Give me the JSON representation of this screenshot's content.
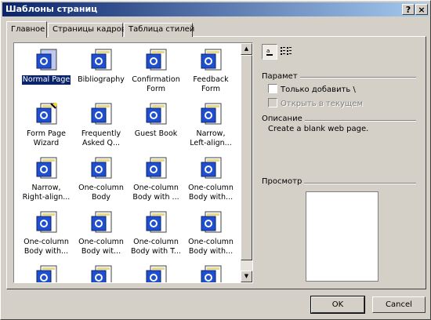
{
  "window": {
    "title": "Шаблоны страниц",
    "help_label": "?",
    "close_label": "×"
  },
  "tabs": [
    {
      "label": "Главное",
      "active": true
    },
    {
      "label": "Страницы кадров",
      "active": false
    },
    {
      "label": "Таблица стилей",
      "active": false
    }
  ],
  "templates": [
    {
      "label": "Normal Page",
      "icon": "normal-page-icon",
      "selected": true
    },
    {
      "label": "Bibliography",
      "icon": "template-page-icon"
    },
    {
      "label": "Confirmation\nForm",
      "icon": "template-page-icon"
    },
    {
      "label": "Feedback\nForm",
      "icon": "template-page-icon"
    },
    {
      "label": "Form Page\nWizard",
      "icon": "wizard-page-icon"
    },
    {
      "label": "Frequently\nAsked Q...",
      "icon": "template-page-icon"
    },
    {
      "label": "Guest Book",
      "icon": "template-page-icon"
    },
    {
      "label": "Narrow,\nLeft-align...",
      "icon": "template-page-icon"
    },
    {
      "label": "Narrow,\nRight-align...",
      "icon": "template-page-icon"
    },
    {
      "label": "One-column\nBody",
      "icon": "template-page-icon"
    },
    {
      "label": "One-column\nBody with ...",
      "icon": "template-page-icon"
    },
    {
      "label": "One-column\nBody with...",
      "icon": "template-page-icon"
    },
    {
      "label": "One-column\nBody with...",
      "icon": "template-page-icon"
    },
    {
      "label": "One-column\nBody wit...",
      "icon": "template-page-icon"
    },
    {
      "label": "One-column\nBody with T...",
      "icon": "template-page-icon"
    },
    {
      "label": "One-column\nBody with...",
      "icon": "template-page-icon"
    },
    {
      "label": "",
      "icon": "template-page-icon"
    },
    {
      "label": "",
      "icon": "template-page-icon"
    },
    {
      "label": "",
      "icon": "template-page-icon"
    },
    {
      "label": "",
      "icon": "template-page-icon"
    }
  ],
  "view_buttons": {
    "large_icons": "large-icons-view-icon",
    "list": "list-view-icon"
  },
  "options": {
    "label": "Парамет",
    "only_add": "Только добавить \\",
    "open_in_current": "Открыть в текущем"
  },
  "description": {
    "label": "Описание",
    "text": "Create a blank web page."
  },
  "preview": {
    "label": "Просмотр"
  },
  "buttons": {
    "ok": "OK",
    "cancel": "Cancel"
  },
  "colors": {
    "face": "#d4d0c8",
    "title_start": "#0a246a",
    "title_end": "#a6caf0",
    "selection": "#0a246a"
  }
}
